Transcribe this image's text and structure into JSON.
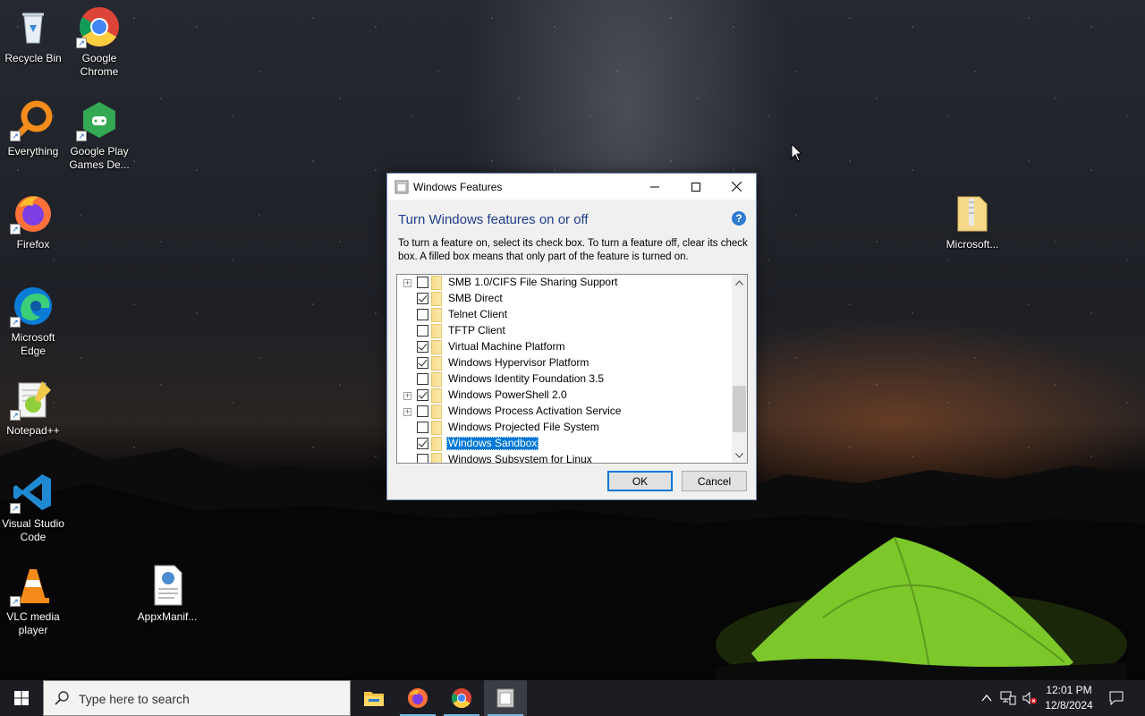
{
  "desktop": {
    "icons": [
      {
        "label_line1": "Recycle Bin",
        "label_line2": ""
      },
      {
        "label_line1": "Google",
        "label_line2": "Chrome"
      },
      {
        "label_line1": "Everything",
        "label_line2": ""
      },
      {
        "label_line1": "Google Play",
        "label_line2": "Games De..."
      },
      {
        "label_line1": "Firefox",
        "label_line2": ""
      },
      {
        "label_line1": "Microsoft",
        "label_line2": "Edge"
      },
      {
        "label_line1": "Notepad++",
        "label_line2": ""
      },
      {
        "label_line1": "Visual Studio",
        "label_line2": "Code"
      },
      {
        "label_line1": "VLC media",
        "label_line2": "player"
      },
      {
        "label_line1": "AppxManif...",
        "label_line2": ""
      },
      {
        "label_line1": "Microsoft...",
        "label_line2": ""
      }
    ]
  },
  "window": {
    "title": "Windows Features",
    "heading": "Turn Windows features on or off",
    "help_glyph": "?",
    "description": "To turn a feature on, select its check box. To turn a feature off, clear its check box. A filled box means that only part of the feature is turned on.",
    "features": [
      {
        "label": "SMB 1.0/CIFS File Sharing Support",
        "checked": false,
        "expandable": true,
        "selected": false
      },
      {
        "label": "SMB Direct",
        "checked": true,
        "expandable": false,
        "selected": false
      },
      {
        "label": "Telnet Client",
        "checked": false,
        "expandable": false,
        "selected": false
      },
      {
        "label": "TFTP Client",
        "checked": false,
        "expandable": false,
        "selected": false
      },
      {
        "label": "Virtual Machine Platform",
        "checked": true,
        "expandable": false,
        "selected": false
      },
      {
        "label": "Windows Hypervisor Platform",
        "checked": true,
        "expandable": false,
        "selected": false
      },
      {
        "label": "Windows Identity Foundation 3.5",
        "checked": false,
        "expandable": false,
        "selected": false
      },
      {
        "label": "Windows PowerShell 2.0",
        "checked": true,
        "expandable": true,
        "selected": false
      },
      {
        "label": "Windows Process Activation Service",
        "checked": false,
        "expandable": true,
        "selected": false
      },
      {
        "label": "Windows Projected File System",
        "checked": false,
        "expandable": false,
        "selected": false
      },
      {
        "label": "Windows Sandbox",
        "checked": true,
        "expandable": false,
        "selected": true
      },
      {
        "label": "Windows Subsystem for Linux",
        "checked": false,
        "expandable": false,
        "selected": false
      }
    ],
    "ok_label": "OK",
    "cancel_label": "Cancel"
  },
  "taskbar": {
    "search_placeholder": "Type here to search",
    "time": "12:01 PM",
    "date": "12/8/2024"
  },
  "colors": {
    "accent": "#0078d7",
    "heading": "#1f3d8a",
    "taskbar": "#1b1d22"
  }
}
